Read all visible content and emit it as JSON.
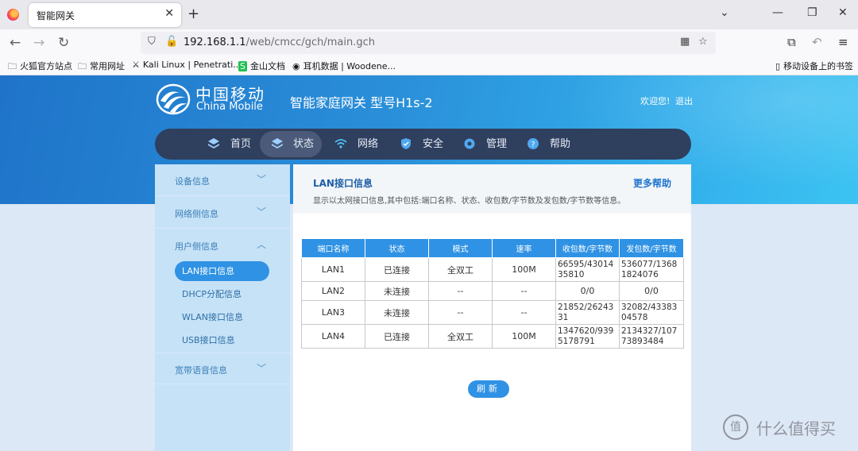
{
  "browser": {
    "tab_title": "智能网关",
    "url_host": "192.168.1.1",
    "url_path": "/web/cmcc/gch/main.gch",
    "bookmarks": [
      "火狐官方站点",
      "常用网址",
      "Kali Linux | Penetrati...",
      "金山文档",
      "耳机数据 | Woodene..."
    ],
    "mobile_bookmarks": "移动设备上的书签"
  },
  "header": {
    "brand_cn": "中国移动",
    "brand_en": "China Mobile",
    "gateway_title": "智能家庭网关 型号H1s-2",
    "welcome": "欢迎您!",
    "logout": "退出"
  },
  "mainnav": [
    {
      "label": "首页",
      "icon": "layers-icon"
    },
    {
      "label": "状态",
      "icon": "layers-icon"
    },
    {
      "label": "网络",
      "icon": "wifi-icon"
    },
    {
      "label": "安全",
      "icon": "shield-icon"
    },
    {
      "label": "管理",
      "icon": "gear-icon"
    },
    {
      "label": "帮助",
      "icon": "help-icon"
    }
  ],
  "sidebar": {
    "groups": [
      "设备信息",
      "网络侧信息",
      "用户侧信息",
      "宽带语音信息"
    ],
    "sub_items": [
      "LAN接口信息",
      "DHCP分配信息",
      "WLAN接口信息",
      "USB接口信息"
    ]
  },
  "content": {
    "title": "LAN接口信息",
    "more_help": "更多帮助",
    "description": "显示以太网接口信息,其中包括:端口名称、状态、收包数/字节数及发包数/字节数等信息。",
    "refresh": "刷新",
    "table": {
      "headers": [
        "端口名称",
        "状态",
        "模式",
        "速率",
        "收包数/字节数",
        "发包数/字节数"
      ],
      "rows": [
        [
          "LAN1",
          "已连接",
          "全双工",
          "100M",
          "66595/4301435810",
          "536077/13681824076"
        ],
        [
          "LAN2",
          "未连接",
          "--",
          "--",
          "0/0",
          "0/0"
        ],
        [
          "LAN3",
          "未连接",
          "--",
          "--",
          "21852/2624331",
          "32082/4338304578"
        ],
        [
          "LAN4",
          "已连接",
          "全双工",
          "100M",
          "1347620/9395178791",
          "2134327/10773893484"
        ]
      ]
    }
  },
  "watermark": "值 | 什么值得买",
  "colors": {
    "accent": "#2f92e4",
    "nav_dark": "#2f3f5e",
    "hero_start": "#1f74c9",
    "hero_end": "#3cc3f2"
  }
}
